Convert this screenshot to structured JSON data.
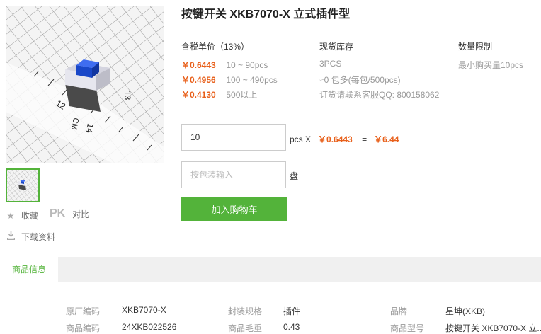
{
  "product": {
    "title": "按键开关 XKB7070-X 立式插件型"
  },
  "gallery": {
    "ruler_labels": [
      "12",
      "13",
      "14",
      "CM"
    ]
  },
  "actions": {
    "favorite_label": "收藏",
    "pk_label": "PK",
    "compare_label": "对比",
    "download_label": "下载资料"
  },
  "pricing": {
    "header": "含税单价（13%）",
    "tiers": [
      {
        "price": "￥0.6443",
        "qty": "10 ~ 90pcs"
      },
      {
        "price": "￥0.4956",
        "qty": "100 ~ 490pcs"
      },
      {
        "price": "￥0.4130",
        "qty": "500以上"
      }
    ]
  },
  "stock": {
    "header": "现货库存",
    "line1": "3PCS",
    "line2": "≈0 包多(每包/500pcs)",
    "line3": "订货请联系客服QQ: 800158062"
  },
  "limit": {
    "header": "数量限制",
    "text": "最小购买量10pcs"
  },
  "order": {
    "quantity_value": "10",
    "unit_label": "pcs X",
    "unit_price": "￥0.6443",
    "equals": "=",
    "total": "￥6.44",
    "pack_placeholder": "按包装输入",
    "pack_unit": "盘",
    "add_to_cart": "加入购物车"
  },
  "tabs": {
    "active": "商品信息"
  },
  "specs": [
    {
      "label": "原厂编码",
      "value": "XKB7070-X"
    },
    {
      "label": "封装规格",
      "value": "插件"
    },
    {
      "label": "品牌",
      "value": "星坤(XKB)"
    },
    {
      "label": "商品编码",
      "value": "24XKB022526"
    },
    {
      "label": "商品毛重",
      "value": "0.43"
    },
    {
      "label": "商品型号",
      "value": "按键开关 XKB7070-X 立..."
    }
  ],
  "colors": {
    "accent_green": "#53b33a",
    "price_orange": "#e8601b"
  }
}
